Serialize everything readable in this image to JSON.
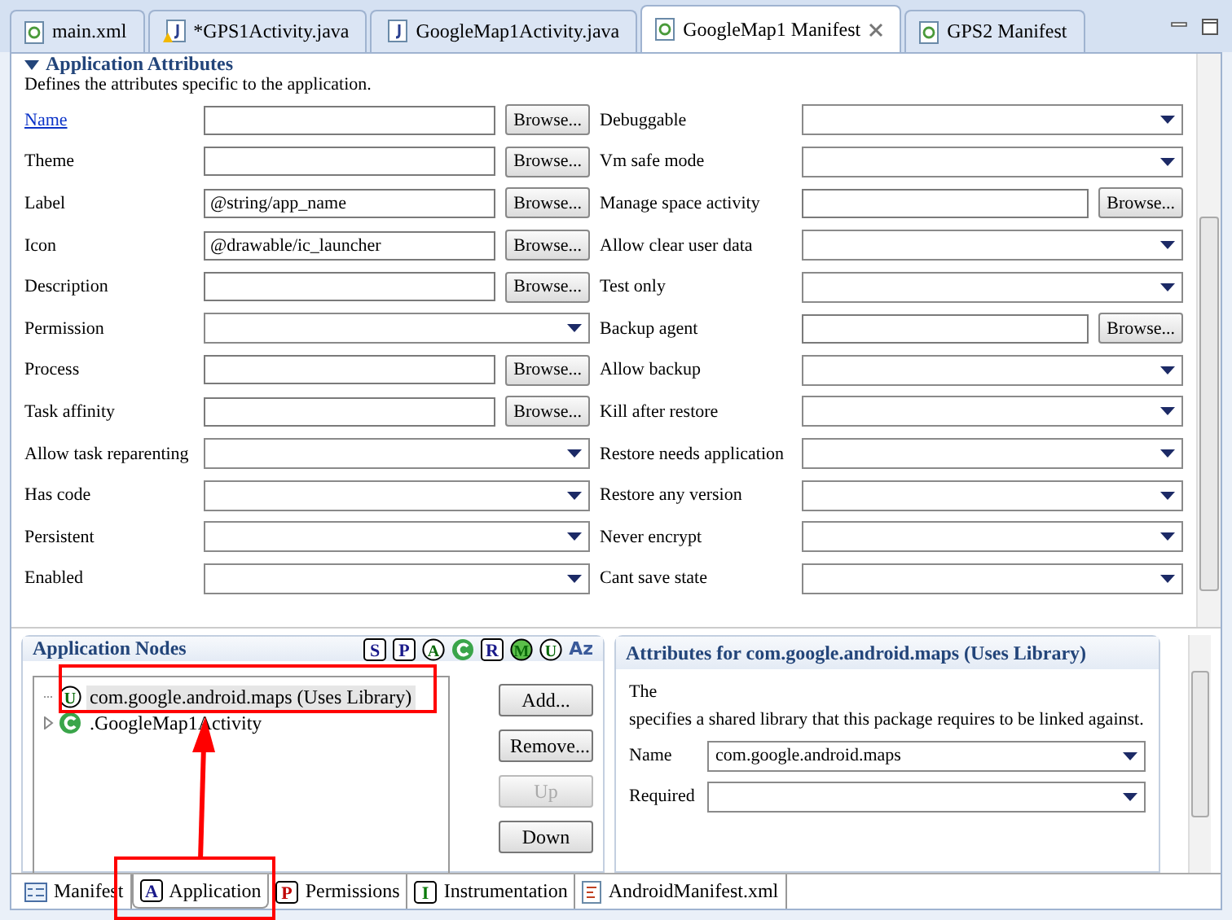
{
  "editor_tabs": [
    {
      "label": "main.xml",
      "kind": "xml",
      "selected": false
    },
    {
      "label": "*GPS1Activity.java",
      "kind": "java-warn",
      "selected": false
    },
    {
      "label": "GoogleMap1Activity.java",
      "kind": "java",
      "selected": false
    },
    {
      "label": "GoogleMap1 Manifest",
      "kind": "xml",
      "selected": true
    },
    {
      "label": "GPS2 Manifest",
      "kind": "xml",
      "selected": false
    }
  ],
  "section": {
    "title": "Application Attributes",
    "description": "Defines the attributes specific to the application."
  },
  "left_fields": [
    {
      "label": "Name",
      "link": true,
      "kind": "text",
      "button": "Browse..."
    },
    {
      "label": "Theme",
      "kind": "text",
      "button": "Browse..."
    },
    {
      "label": "Label",
      "kind": "text",
      "value": "@string/app_name",
      "button": "Browse..."
    },
    {
      "label": "Icon",
      "kind": "text",
      "value": "@drawable/ic_launcher",
      "button": "Browse..."
    },
    {
      "label": "Description",
      "kind": "text",
      "button": "Browse..."
    },
    {
      "label": "Permission",
      "kind": "combo"
    },
    {
      "label": "Process",
      "kind": "text",
      "button": "Browse..."
    },
    {
      "label": "Task affinity",
      "kind": "text",
      "button": "Browse..."
    },
    {
      "label": "Allow task reparenting",
      "kind": "combo"
    },
    {
      "label": "Has code",
      "kind": "combo"
    },
    {
      "label": "Persistent",
      "kind": "combo"
    },
    {
      "label": "Enabled",
      "kind": "combo"
    }
  ],
  "right_fields": [
    {
      "label": "Debuggable",
      "kind": "combo"
    },
    {
      "label": "Vm safe mode",
      "kind": "combo"
    },
    {
      "label": "Manage space activity",
      "kind": "text",
      "button": "Browse..."
    },
    {
      "label": "Allow clear user data",
      "kind": "combo"
    },
    {
      "label": "Test only",
      "kind": "combo"
    },
    {
      "label": "Backup agent",
      "kind": "text",
      "button": "Browse..."
    },
    {
      "label": "Allow backup",
      "kind": "combo"
    },
    {
      "label": "Kill after restore",
      "kind": "combo"
    },
    {
      "label": "Restore needs application",
      "kind": "combo"
    },
    {
      "label": "Restore any version",
      "kind": "combo"
    },
    {
      "label": "Never encrypt",
      "kind": "combo"
    },
    {
      "label": "Cant save state",
      "kind": "combo"
    }
  ],
  "nodes": {
    "title": "Application Nodes",
    "toolbar": [
      {
        "letter": "S",
        "kind": "square"
      },
      {
        "letter": "P",
        "kind": "square"
      },
      {
        "letter": "A",
        "kind": "circle"
      },
      {
        "kind": "filled"
      },
      {
        "letter": "R",
        "kind": "square"
      },
      {
        "letter": "M",
        "kind": "circle-fill"
      },
      {
        "letter": "U",
        "kind": "circle"
      },
      {
        "letter": "Az",
        "kind": "sort"
      }
    ],
    "tree": [
      {
        "letter": "U",
        "kind": "circle",
        "label": "com.google.android.maps (Uses Library)",
        "selected": true,
        "expandable": false
      },
      {
        "kind": "filled",
        "label": ".GoogleMap1Activity",
        "selected": false,
        "expandable": true
      }
    ],
    "buttons": [
      {
        "label": "Add...",
        "disabled": false
      },
      {
        "label": "Remove...",
        "disabled": false
      },
      {
        "label": "Up",
        "disabled": true
      },
      {
        "label": "Down",
        "disabled": false
      }
    ]
  },
  "attributes": {
    "title": "Attributes for com.google.android.maps (Uses Library)",
    "text_1": "The",
    "text_2": " specifies a shared library that this package requires to be linked against.",
    "fields": [
      {
        "label": "Name",
        "value": "com.google.android.maps"
      },
      {
        "label": "Required"
      }
    ]
  },
  "bottom_tabs": [
    {
      "label": "Manifest",
      "kind": "form",
      "selected": false
    },
    {
      "label": "Application",
      "kind": "A",
      "selected": true
    },
    {
      "label": "Permissions",
      "kind": "P",
      "selected": false
    },
    {
      "label": "Instrumentation",
      "kind": "I",
      "selected": false
    },
    {
      "label": "AndroidManifest.xml",
      "kind": "file",
      "selected": false
    }
  ]
}
